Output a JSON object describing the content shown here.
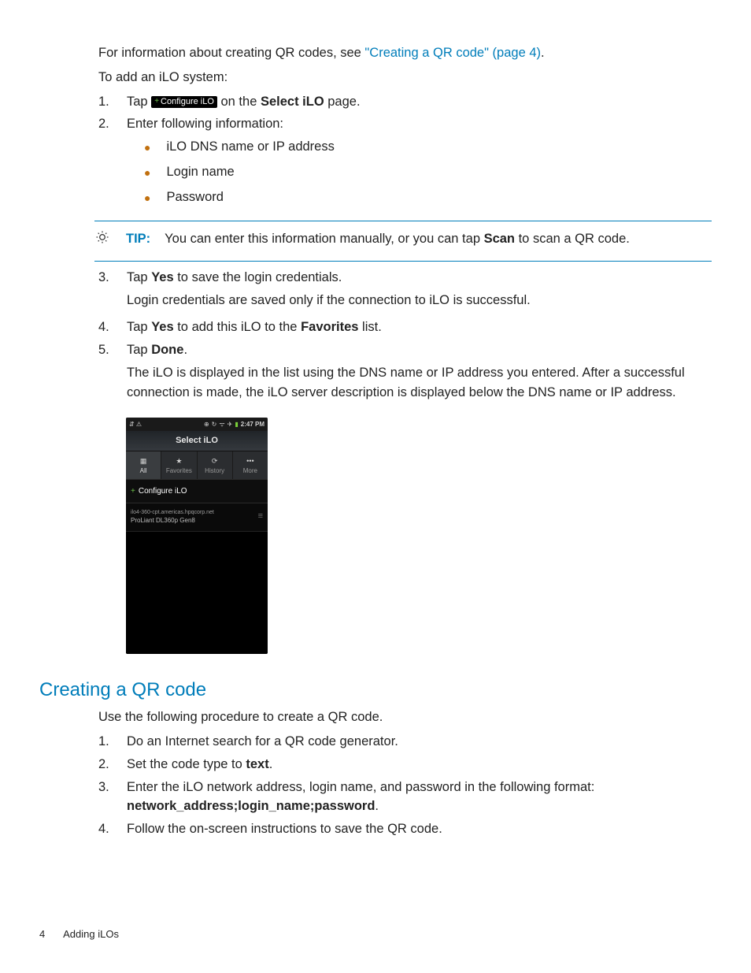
{
  "intro": {
    "line1_a": "For information about creating QR codes, see ",
    "line1_link": "\"Creating a QR code\" (page 4)",
    "line1_b": ".",
    "line2": "To add an iLO system:"
  },
  "steps1": {
    "s1": {
      "num": "1.",
      "a": "Tap ",
      "chip": "Configure iLO",
      "b": " on the ",
      "bold": "Select iLO",
      "c": " page."
    },
    "s2": {
      "num": "2.",
      "text": "Enter following information:"
    },
    "s2sub": {
      "a": "iLO DNS name or IP address",
      "b": "Login name",
      "c": "Password"
    }
  },
  "tip": {
    "label": "TIP:",
    "a": "You can enter this information manually, or you can tap ",
    "bold": "Scan",
    "b": " to scan a QR code."
  },
  "steps2": {
    "s3": {
      "num": "3.",
      "a": "Tap ",
      "b1": "Yes",
      "c": " to save the login credentials.",
      "line2": "Login credentials are saved only if the connection to iLO is successful."
    },
    "s4": {
      "num": "4.",
      "a": "Tap ",
      "b1": "Yes",
      "c": " to add this iLO to the ",
      "b2": "Favorites",
      "d": " list."
    },
    "s5": {
      "num": "5.",
      "a": "Tap ",
      "b1": "Done",
      "c": ".",
      "line2": "The iLO is displayed in the list using the DNS name or IP address you entered. After a successful connection is made, the iLO server description is displayed below the DNS name or IP address."
    }
  },
  "phone": {
    "time": "2:47 PM",
    "title": "Select iLO",
    "tabs": {
      "all": "All",
      "fav": "Favorites",
      "hist": "History",
      "more": "More"
    },
    "row1": "Configure iLO",
    "row2a": "ilo4-360-cpt.americas.hpqcorp.net",
    "row2b": "ProLiant DL360p Gen8"
  },
  "section2": {
    "title": "Creating a QR code",
    "intro": "Use the following procedure to create a QR code.",
    "s1": {
      "num": "1.",
      "text": "Do an Internet search for a QR code generator."
    },
    "s2": {
      "num": "2.",
      "a": "Set the code type to ",
      "b": "text",
      "c": "."
    },
    "s3": {
      "num": "3.",
      "line1": "Enter the iLO network address, login name, and password in the following format:",
      "bold": "network_address;login_name;password",
      "c": "."
    },
    "s4": {
      "num": "4.",
      "text": "Follow the on-screen instructions to save the QR code."
    }
  },
  "footer": {
    "page": "4",
    "section": "Adding iLOs"
  }
}
